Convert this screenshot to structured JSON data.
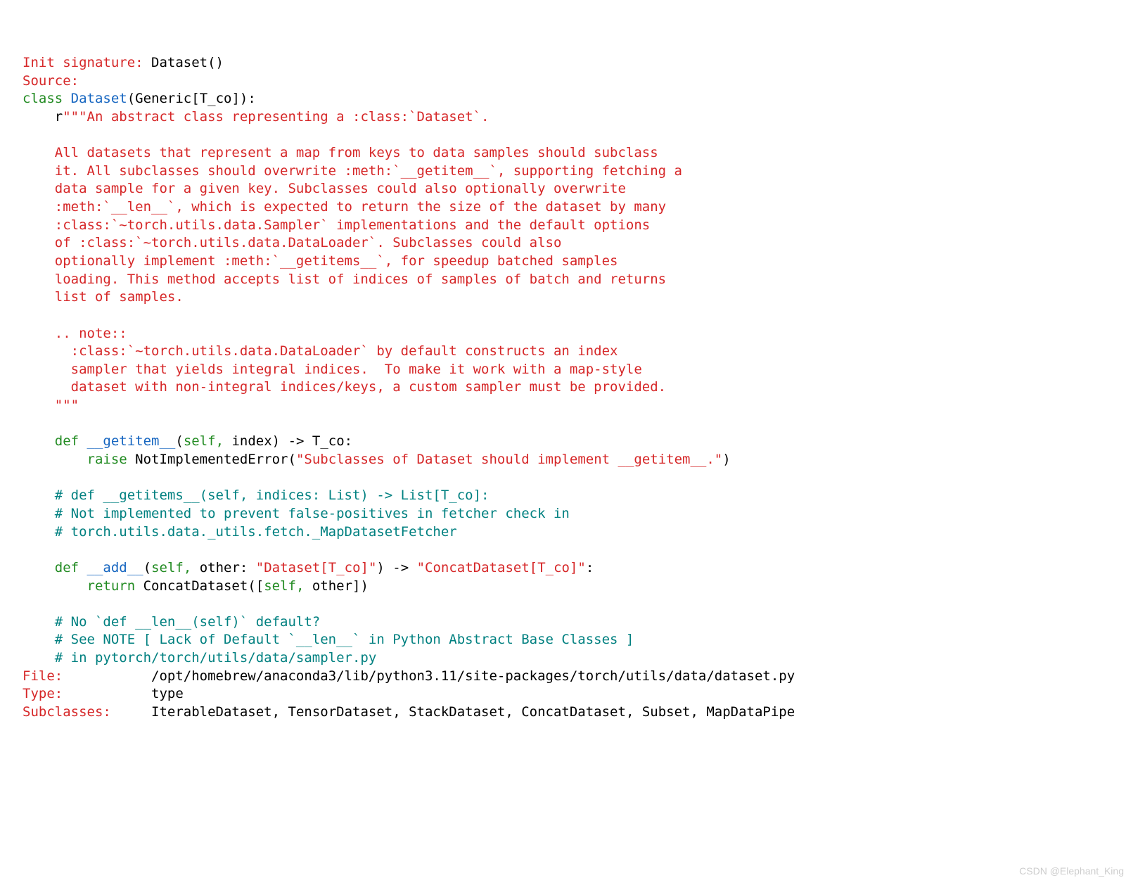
{
  "header": {
    "init_sig_label": "Init signature:",
    "init_sig_value": " Dataset()",
    "source_label": "Source:"
  },
  "class_decl": {
    "kw_class": "class",
    "name": " Dataset",
    "open": "(",
    "generic": "Generic",
    "bracket_open": "[",
    "tco": "T_co",
    "bracket_close": "]",
    "close": "):"
  },
  "doc": {
    "prefix": "    r",
    "d1": "\"\"\"An abstract class representing a :class:`Dataset`.",
    "b1": "",
    "p1": "    All datasets that represent a map from keys to data samples should subclass",
    "p2": "    it. All subclasses should overwrite :meth:`__getitem__`, supporting fetching a",
    "p3": "    data sample for a given key. Subclasses could also optionally overwrite",
    "p4": "    :meth:`__len__`, which is expected to return the size of the dataset by many",
    "p5": "    :class:`~torch.utils.data.Sampler` implementations and the default options",
    "p6": "    of :class:`~torch.utils.data.DataLoader`. Subclasses could also",
    "p7": "    optionally implement :meth:`__getitems__`, for speedup batched samples",
    "p8": "    loading. This method accepts list of indices of samples of batch and returns",
    "p9": "    list of samples.",
    "b2": "",
    "n1": "    .. note::",
    "n2": "      :class:`~torch.utils.data.DataLoader` by default constructs an index",
    "n3": "      sampler that yields integral indices.  To make it work with a map-style",
    "n4": "      dataset with non-integral indices/keys, a custom sampler must be provided.",
    "end": "    \"\"\""
  },
  "getitem": {
    "indent": "    ",
    "def": "def",
    "name": " __getitem__",
    "args_open": "(",
    "self": "self,",
    "index": " index",
    "args_close": ")",
    "arrow": " ->",
    "ret": " T_co",
    "colon": ":",
    "body_indent": "        ",
    "raise": "raise",
    "exc": " NotImplementedError",
    "msg_open": "(",
    "msg": "\"Subclasses of Dataset should implement __getitem__.\"",
    "msg_close": ")"
  },
  "comments1": {
    "c1": "    # def __getitems__(self, indices: List) -> List[T_co]:",
    "c2": "    # Not implemented to prevent false-positives in fetcher check in",
    "c3": "    # torch.utils.data._utils.fetch._MapDatasetFetcher"
  },
  "add": {
    "indent": "    ",
    "def": "def",
    "name": " __add__",
    "open": "(",
    "self": "self,",
    "other": " other",
    "colon1": ":",
    "t1": " \"Dataset[T_co]\"",
    "close": ")",
    "arrow": " ->",
    "t2": " \"ConcatDataset[T_co]\"",
    "colon2": ":",
    "body_indent": "        ",
    "return": "return",
    "concat": " ConcatDataset",
    "args_open": "([",
    "arg_self": "self,",
    "arg_other": " other",
    "args_close": "])"
  },
  "comments2": {
    "c1": "    # No `def __len__(self)` default?",
    "c2": "    # See NOTE [ Lack of Default `__len__` in Python Abstract Base Classes ]",
    "c3": "    # in pytorch/torch/utils/data/sampler.py"
  },
  "footer": {
    "file_label": "File:",
    "file_value": "           /opt/homebrew/anaconda3/lib/python3.11/site-packages/torch/utils/data/dataset.py",
    "type_label": "Type:",
    "type_value": "           type",
    "sub_label": "Subclasses:",
    "sub_value": "     IterableDataset, TensorDataset, StackDataset, ConcatDataset, Subset, MapDataPipe"
  },
  "watermark": "CSDN @Elephant_King"
}
